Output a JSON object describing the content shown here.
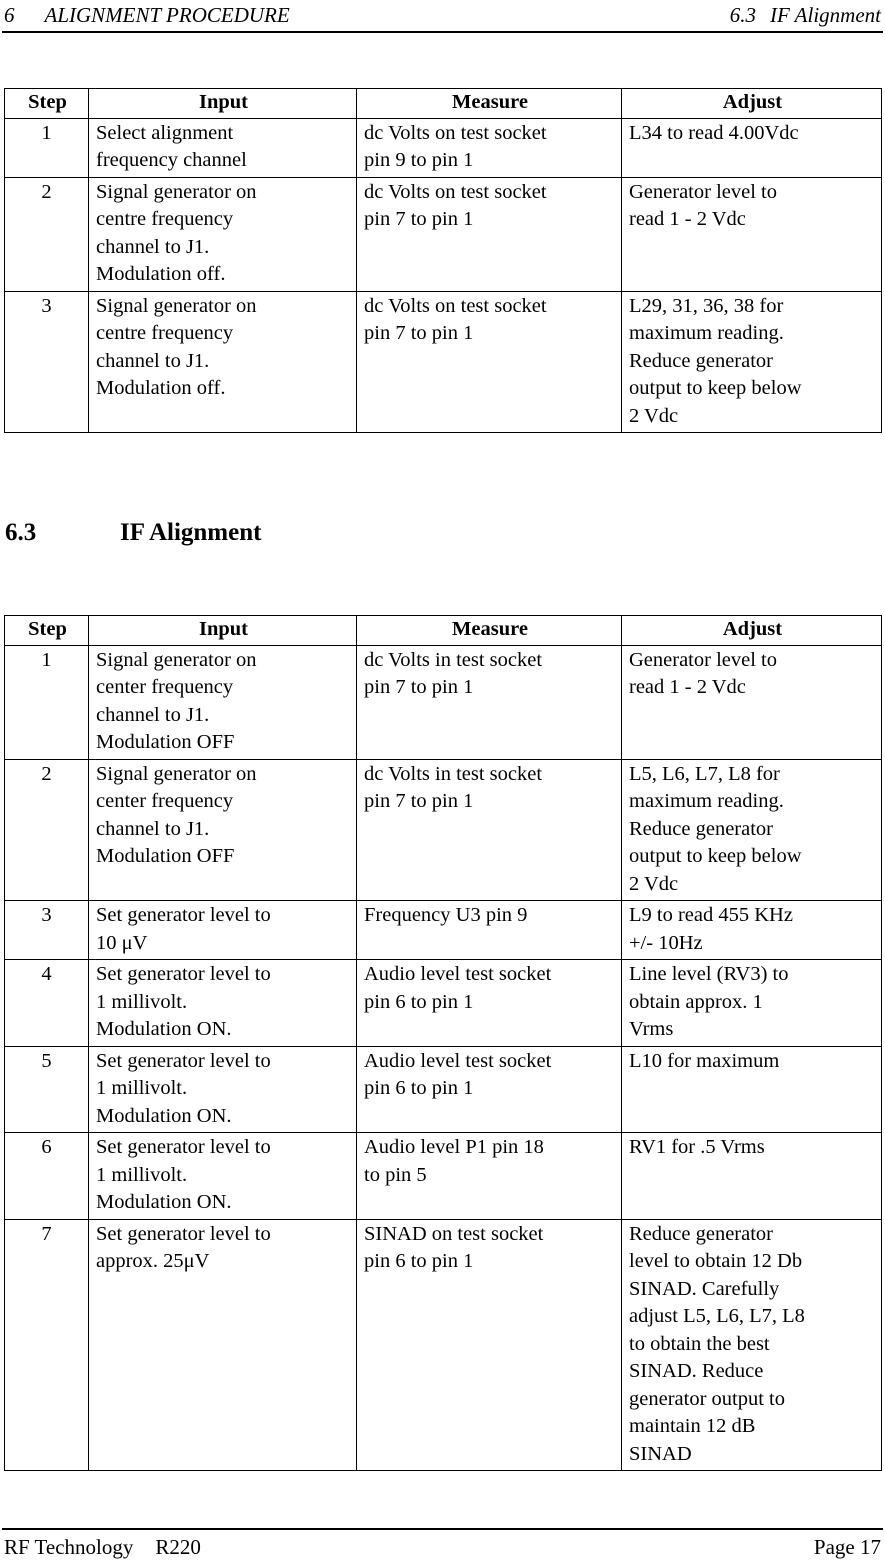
{
  "header": {
    "chapter_number": "6",
    "chapter_title": "ALIGNMENT PROCEDURE",
    "section_number": "6.3",
    "section_title": "IF Alignment"
  },
  "section": {
    "number": "6.3",
    "title": "IF Alignment"
  },
  "tables": {
    "alignment": {
      "columns": [
        "Step",
        "Input",
        "Measure",
        "Adjust"
      ],
      "rows": [
        {
          "step": "1",
          "input": [
            "Select alignment",
            "frequency channel"
          ],
          "measure": [
            "dc Volts on test socket",
            "pin 9 to pin 1"
          ],
          "adjust": [
            "L34 to read 4.00Vdc"
          ]
        },
        {
          "step": "2",
          "input": [
            "Signal generator on",
            "centre frequency",
            "channel to J1.",
            "Modulation off."
          ],
          "measure": [
            "dc Volts on test socket",
            "pin 7 to pin 1"
          ],
          "adjust": [
            "Generator level to",
            "read 1 - 2 Vdc"
          ]
        },
        {
          "step": "3",
          "input": [
            "Signal generator on",
            "centre frequency",
            "channel to J1.",
            "Modulation off."
          ],
          "measure": [
            "dc Volts on test socket",
            "pin 7 to pin 1"
          ],
          "adjust": [
            "L29, 31, 36, 38 for",
            "maximum reading.",
            "Reduce generator",
            "output to keep below",
            "2 Vdc"
          ]
        }
      ]
    },
    "if_alignment": {
      "columns": [
        "Step",
        "Input",
        "Measure",
        "Adjust"
      ],
      "rows": [
        {
          "step": "1",
          "input": [
            "Signal generator on",
            "center frequency",
            "channel to J1.",
            "Modulation OFF"
          ],
          "measure": [
            "dc Volts in test socket",
            "pin 7 to pin 1"
          ],
          "adjust": [
            "Generator level to",
            "read 1 - 2 Vdc"
          ]
        },
        {
          "step": "2",
          "input": [
            "Signal generator on",
            "center frequency",
            "channel to J1.",
            "Modulation OFF"
          ],
          "measure": [
            "dc Volts in test socket",
            "pin 7 to pin 1"
          ],
          "adjust": [
            "L5, L6, L7, L8 for",
            "maximum reading.",
            "Reduce generator",
            "output to keep below",
            "2 Vdc"
          ]
        },
        {
          "step": "3",
          "input": [
            "Set generator level to",
            "10 μV"
          ],
          "measure": [
            "Frequency U3 pin 9"
          ],
          "adjust": [
            "L9 to read 455 KHz",
            "+/- 10Hz"
          ]
        },
        {
          "step": "4",
          "input": [
            "Set generator level to",
            "1 millivolt.",
            "Modulation ON."
          ],
          "measure": [
            "Audio level test socket",
            "pin 6 to pin 1"
          ],
          "adjust": [
            "Line level (RV3) to",
            "obtain approx. 1",
            "Vrms"
          ]
        },
        {
          "step": "5",
          "input": [
            "Set generator level to",
            "1 millivolt.",
            "Modulation ON."
          ],
          "measure": [
            "Audio level test socket",
            "pin 6 to pin 1"
          ],
          "adjust": [
            "L10 for maximum"
          ]
        },
        {
          "step": "6",
          "input": [
            "Set generator level to",
            "1 millivolt.",
            "Modulation ON."
          ],
          "measure": [
            "Audio level P1 pin 18",
            "to pin 5"
          ],
          "adjust": [
            "RV1 for .5 Vrms"
          ]
        },
        {
          "step": "7",
          "input": [
            "Set generator level to",
            "approx. 25μV"
          ],
          "measure": [
            "SINAD on test socket",
            "pin 6 to pin 1"
          ],
          "adjust": [
            "Reduce generator",
            "level to obtain 12 Db",
            "SINAD.  Carefully",
            "adjust L5, L6, L7, L8",
            "to obtain the best",
            "SINAD.  Reduce",
            "generator output to",
            "maintain 12 dB",
            "SINAD"
          ]
        }
      ]
    }
  },
  "footer": {
    "company": "RF Technology",
    "product": "R220",
    "page": "Page 17"
  }
}
